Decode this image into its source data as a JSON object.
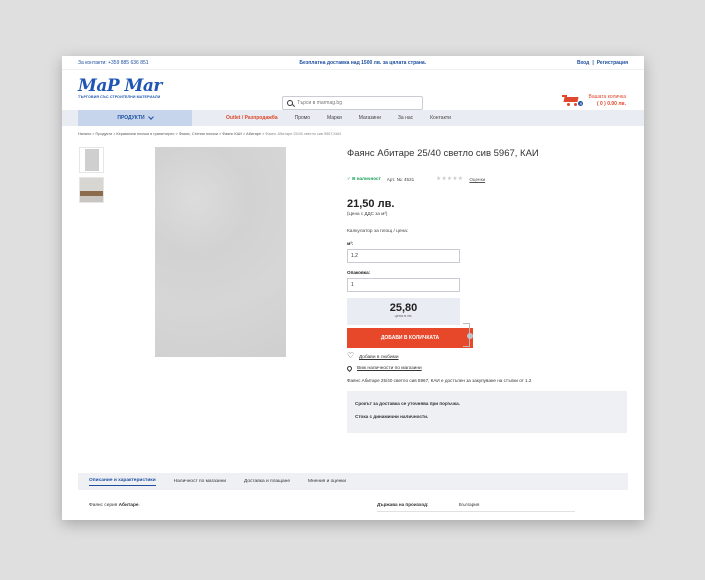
{
  "topbar": {
    "contacts": "За контакти: +359 885 636 851",
    "promo": "Безплатна доставка над 1500 лв. за цялата страна.",
    "login": "Вход",
    "separator": "|",
    "register": "Регистрация"
  },
  "header": {
    "logo_text": "MaP Mar",
    "logo_subtitle": "ТЪРГОВИЯ СЪС СТРОИТЕЛНИ МАТЕРИАЛИ",
    "search_placeholder": "Търси в marmag.bg",
    "cart_label": "Вашата количка",
    "cart_total": "( 0 ) 0.00 лв."
  },
  "nav": {
    "products": "ПРОДУКТИ",
    "items": [
      "Outlet / Разпродажба",
      "Промо",
      "Марки",
      "Магазини",
      "За нас",
      "Контакти"
    ]
  },
  "breadcrumb": {
    "path": "Начало  >  Продукти  >  Керамични плочки и гранитогрес  >  Фаянс, Стенни плочки  >  Фаянс КАИ  >  Абитаре  >  ",
    "current": "Фаянс Абитаре 25/40 светло сив 5967,КАИ"
  },
  "product": {
    "title": "Фаянс Абитаре 25/40 светло сив 5967, КАИ",
    "availability": "✓ В наличност",
    "article": "Арт. №: 4531",
    "stars": "★★★★★",
    "reviews_link": "Оценки",
    "price": "21,50 лв.",
    "vat_note": "(Цена с ДДС за м²)",
    "calculator_label": "Калкулатор за площ / цена:",
    "area_label": "м²:",
    "area_value": "1.2",
    "package_label": "Опаковка:",
    "package_value": "1",
    "total_value": "25,80",
    "total_unit": "цена в лв.",
    "add_to_cart": "ДОБАВИ В КОЛИЧКАТА",
    "favorites": "Добави в любими",
    "stores_availability": "Виж наличности по магазини",
    "description": "Фаянс Абитаре 25/40 светло сив 5967, КАИ е достъпен за закупуване на стъпки от 1.2",
    "delivery_note": "Срокът за доставка се уточнява при поръчка.",
    "dynamic_stock_note": "Стока с динамични наличности."
  },
  "tabs": [
    "Описание и характеристики",
    "Наличност по магазини",
    "Доставка и плащане",
    "Мнения и оценки"
  ],
  "details": {
    "series_prefix": "Фаянс серия ",
    "series_name": "Абитаре",
    "series_suffix": ".",
    "spec_key": "Държава на произход:",
    "spec_value": "България"
  },
  "colors": {
    "brand_blue": "#1e4f9f",
    "accent_orange": "#e8482a",
    "in_stock_green": "#1aa15b"
  }
}
